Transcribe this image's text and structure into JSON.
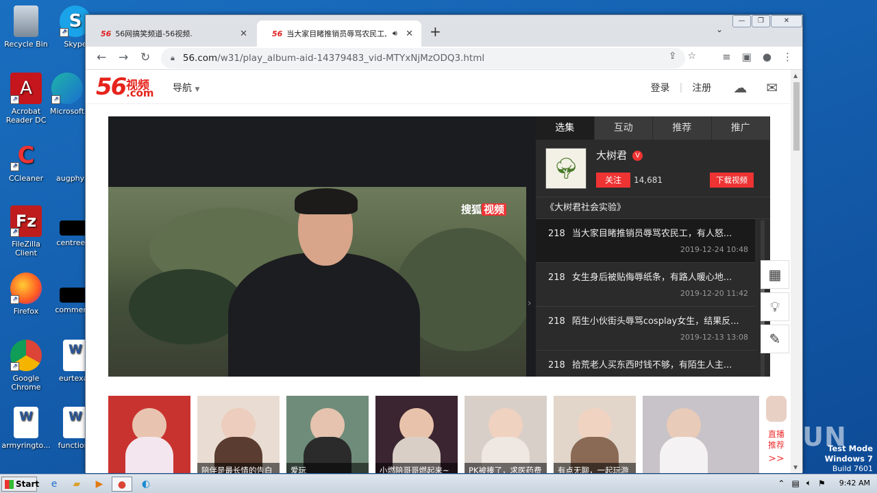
{
  "desktop": {
    "icons": [
      {
        "label": "Recycle Bin"
      },
      {
        "label": "Skype"
      },
      {
        "label": "Acrobat Reader DC"
      },
      {
        "label": "Microsoft"
      },
      {
        "label": "CCleaner"
      },
      {
        "label": "augphysic"
      },
      {
        "label": "FileZilla Client"
      },
      {
        "label": "centreeve"
      },
      {
        "label": "Firefox"
      },
      {
        "label": "commenth"
      },
      {
        "label": "Google Chrome"
      },
      {
        "label": "eurtexas"
      },
      {
        "label": "armyringto..."
      },
      {
        "label": "functions"
      }
    ]
  },
  "browser": {
    "tabs": [
      {
        "favicon": "56",
        "title": "56网搞笑频道-56视频."
      },
      {
        "favicon": "56",
        "title": "当大家目睹推销员辱骂农民工,"
      }
    ],
    "url_host": "56.com",
    "url_path": "/w31/play_album-aid-14379483_vid-MTYxNjMzODQ3.html"
  },
  "site": {
    "logo_num": "56",
    "logo_zh": "视频",
    "logo_com": ".com",
    "nav_label": "导航",
    "login": "登录",
    "register": "注册"
  },
  "player": {
    "watermark_a": "搜狐",
    "watermark_b": "视频",
    "tabs": [
      "选集",
      "互动",
      "推荐",
      "推广"
    ],
    "uploader": {
      "name": "大树君",
      "badge": "V",
      "follow_label": "关注",
      "followers": "14,681",
      "download_label": "下载视频"
    },
    "album_title": "《大树君社会实验》",
    "episodes": [
      {
        "num": "218",
        "title": "当大家目睹推销员辱骂农民工，有人怒...",
        "date": "2019-12-24 10:48"
      },
      {
        "num": "218",
        "title": "女生身后被贴侮辱纸条，有路人暖心地...",
        "date": "2019-12-20 11:42"
      },
      {
        "num": "218",
        "title": "陌生小伙街头辱骂cosplay女生，结果反...",
        "date": "2019-12-13 13:08"
      },
      {
        "num": "218",
        "title": "拾荒老人买东西时钱不够，有陌生人主...",
        "date": ""
      }
    ]
  },
  "strip": {
    "thumbs": [
      {
        "caption": ""
      },
      {
        "caption": "陪伴是最长情的告白"
      },
      {
        "caption": "爱玩"
      },
      {
        "caption": "小燃陪哥哥燃起来~"
      },
      {
        "caption": "PK被揍了，求医药费"
      },
      {
        "caption": "有点无聊，一起玩游"
      },
      {
        "caption": ""
      }
    ],
    "live_label": "直播推荐",
    "live_more": ">>"
  },
  "overlay": {
    "anyrun": "ANY.RUN",
    "testmode_line1": "Test Mode",
    "testmode_line2": "Windows 7",
    "testmode_line3": "Build 7601"
  },
  "taskbar": {
    "start_label": "Start",
    "clock": "9:42 AM"
  }
}
